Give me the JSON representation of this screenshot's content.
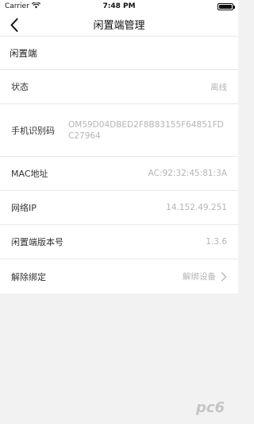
{
  "status_bar": {
    "carrier": "Carrier",
    "time": "7:48 PM"
  },
  "nav": {
    "title": "闲置端管理"
  },
  "section": {
    "title": "闲置端"
  },
  "rows": [
    {
      "label": "状态",
      "value": "离线"
    },
    {
      "label": "手机识别码",
      "value": "OM59D04DBED2F8B83155F64851FDC27964"
    },
    {
      "label": "MAC地址",
      "value": "AC:92:32:45:81:3A"
    },
    {
      "label": "网络IP",
      "value": "14.152.49.251"
    },
    {
      "label": "闲置端版本号",
      "value": "1.3.6"
    },
    {
      "label": "解除绑定",
      "value": "解绑设备"
    }
  ],
  "watermark": "pc6",
  "icons": {
    "back": "chevron-left-icon",
    "wifi": "wifi-icon",
    "battery": "battery-icon",
    "chevron": "chevron-right-icon"
  }
}
